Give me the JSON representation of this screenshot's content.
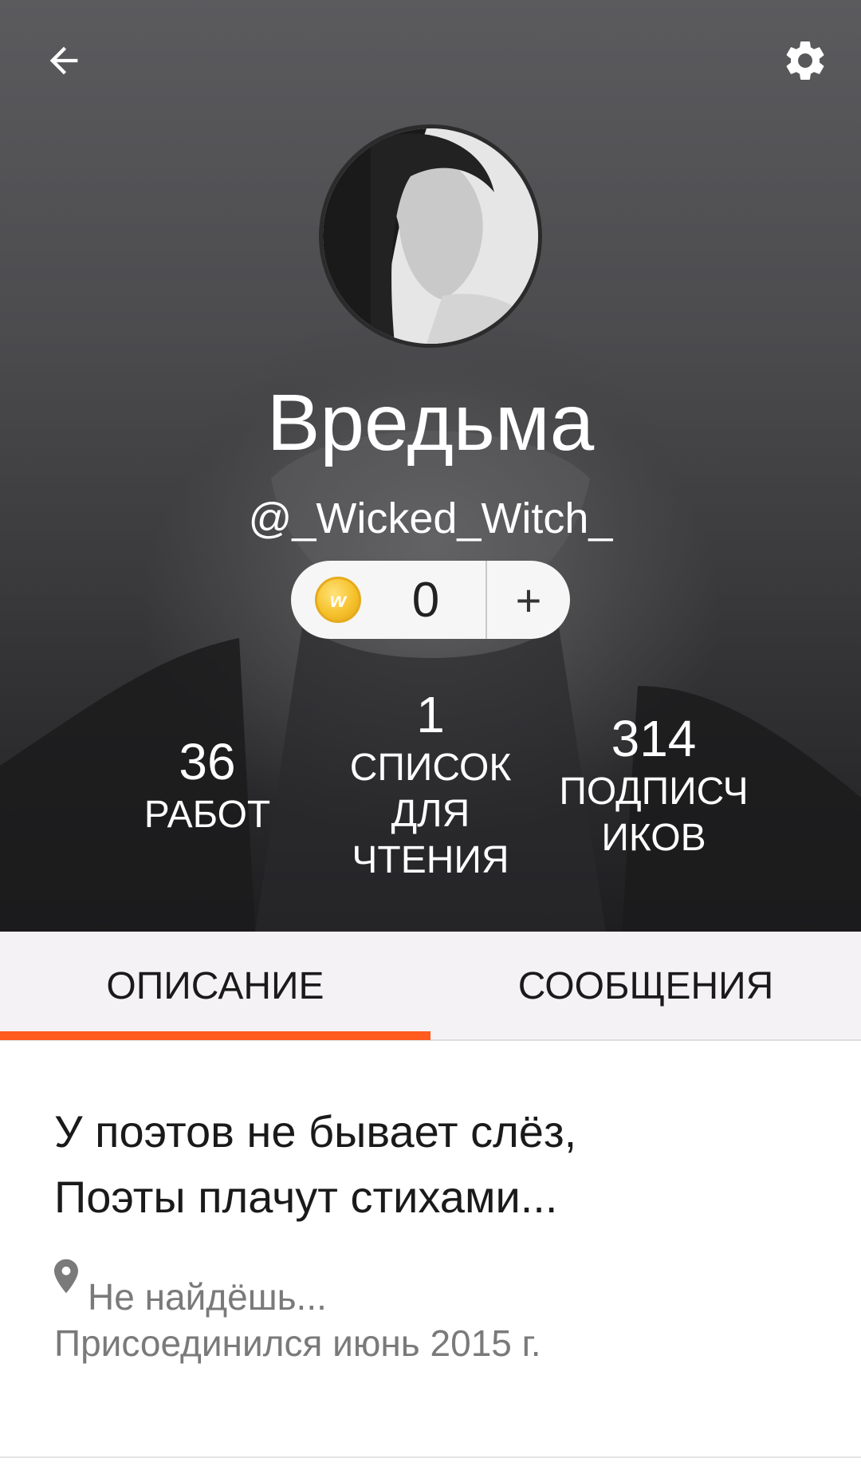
{
  "header": {
    "back_icon": "arrow-left-icon",
    "settings_icon": "gear-icon"
  },
  "profile": {
    "display_name": "Вредьма",
    "username": "@_Wicked_Witch_",
    "coins": {
      "icon": "wattpad-coin-icon",
      "count": "0",
      "add_label": "+"
    }
  },
  "stats": [
    {
      "value": "36",
      "label_lines": [
        "РАБОТ"
      ]
    },
    {
      "value": "1",
      "label_lines": [
        "СПИСОК",
        "ДЛЯ",
        "ЧТЕНИЯ"
      ]
    },
    {
      "value": "314",
      "label_lines": [
        "ПОДПИСЧ",
        "ИКОВ"
      ]
    }
  ],
  "tabs": [
    {
      "label": "ОПИСАНИЕ",
      "active": true
    },
    {
      "label": "СООБЩЕНИЯ",
      "active": false
    }
  ],
  "colors": {
    "accent": "#ff5a1f",
    "tab_bar_bg": "#f4f2f4",
    "secondary_text": "#7a7a7a"
  },
  "about": {
    "bio_lines": [
      "У поэтов не бывает слёз,",
      "Поэты плачут стихами..."
    ],
    "location_icon": "location-pin-icon",
    "location": "Не найдёшь...",
    "joined": "Присоединился июнь 2015 г."
  }
}
